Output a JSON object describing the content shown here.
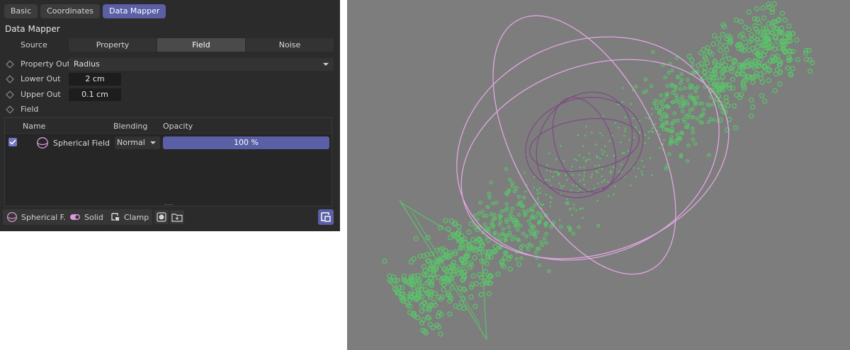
{
  "tabs": [
    {
      "label": "Basic",
      "active": false
    },
    {
      "label": "Coordinates",
      "active": false
    },
    {
      "label": "Data Mapper",
      "active": true
    }
  ],
  "section_title": "Data Mapper",
  "source": {
    "label": "Source",
    "options": [
      "Property",
      "Field",
      "Noise"
    ],
    "selected": "Field"
  },
  "property_out": {
    "label": "Property Out",
    "value": "Radius"
  },
  "lower_out": {
    "label": "Lower Out",
    "value": "2 cm"
  },
  "upper_out": {
    "label": "Upper Out",
    "value": "0.1 cm"
  },
  "field": {
    "label": "Field"
  },
  "field_list": {
    "columns": {
      "name": "Name",
      "blending": "Blending",
      "opacity": "Opacity"
    },
    "rows": [
      {
        "enabled": true,
        "icon": "sphere-icon",
        "name": "Spherical Field",
        "blending": "Normal",
        "opacity_text": "100 %",
        "opacity": 1.0
      }
    ],
    "grip": "....."
  },
  "toolbar": {
    "spherical_label": "Spherical F...",
    "solid_label": "Solid",
    "clamp_label": "Clamp"
  },
  "colors": {
    "accent": "#5a5fa6",
    "panel_bg": "#2b2b2b",
    "viewport_bg": "#7d7d7d",
    "particles": "#5bc26a",
    "field_gizmo": "#e2a6e2",
    "inner_sphere": "#7e4c82"
  }
}
